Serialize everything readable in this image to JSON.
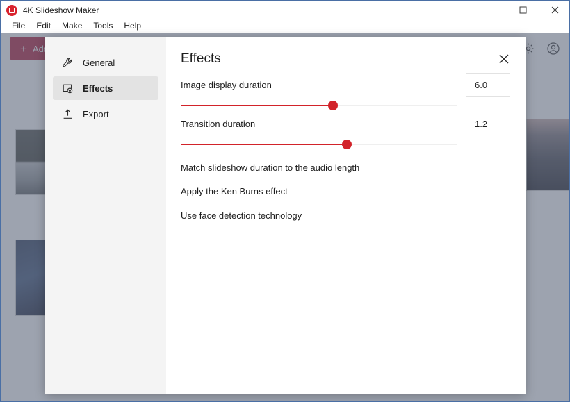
{
  "window": {
    "title": "4K Slideshow Maker",
    "app_icon": "app-logo-icon",
    "minimize": "minimize-icon",
    "maximize": "maximize-icon",
    "close": "close-icon"
  },
  "menubar": {
    "items": [
      {
        "label": "File"
      },
      {
        "label": "Edit"
      },
      {
        "label": "Make"
      },
      {
        "label": "Tools"
      },
      {
        "label": "Help"
      }
    ]
  },
  "toolbar": {
    "add_label": "Add",
    "add_plus": "+",
    "settings_icon": "gear-icon",
    "account_icon": "account-icon"
  },
  "dialog": {
    "title": "Effects",
    "close_icon": "close-icon",
    "nav": [
      {
        "label": "General",
        "icon": "wrench-icon",
        "selected": false
      },
      {
        "label": "Effects",
        "icon": "effects-icon",
        "selected": true
      },
      {
        "label": "Export",
        "icon": "upload-icon",
        "selected": false
      }
    ],
    "sliders": [
      {
        "label": "Image display duration",
        "value": "6.0",
        "percent": 55
      },
      {
        "label": "Transition duration",
        "value": "1.2",
        "percent": 60
      }
    ],
    "toggles": [
      {
        "label": "Match slideshow duration to the audio length",
        "state": "off"
      },
      {
        "label": "Apply the Ken Burns effect",
        "state": "on"
      },
      {
        "label": "Use face detection technology",
        "state": "on"
      }
    ]
  },
  "colors": {
    "accent_red": "#d2232a",
    "add_button": "#b01838",
    "sidebar_bg": "#f4f4f4",
    "selected_nav": "#e3e3e3",
    "overlay": "#616a7e"
  }
}
